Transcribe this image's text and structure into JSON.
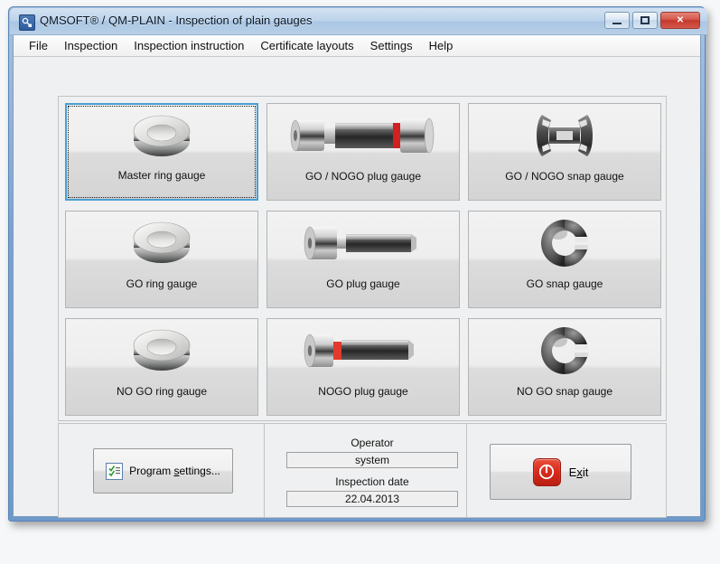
{
  "window": {
    "title": "QMSOFT® / QM-PLAIN - Inspection of plain gauges",
    "app_icon": "qm-app-icon",
    "controls": {
      "minimize": "minimize-button",
      "maximize": "maximize-button",
      "close": "✕"
    },
    "accent_blue": "#6e9ac9",
    "close_red": "#c3392c"
  },
  "menu": {
    "items": [
      {
        "label": "File"
      },
      {
        "label": "Inspection"
      },
      {
        "label": "Inspection instruction"
      },
      {
        "label": "Certificate layouts"
      },
      {
        "label": "Settings"
      },
      {
        "label": "Help"
      }
    ]
  },
  "gauges": {
    "tiles": [
      {
        "label": "Master ring gauge",
        "art": "ring-gauge",
        "selected": true
      },
      {
        "label": "GO / NOGO plug gauge",
        "art": "double-plug-gauge",
        "selected": false
      },
      {
        "label": "GO / NOGO snap gauge",
        "art": "double-snap-gauge",
        "selected": false
      },
      {
        "label": "GO ring gauge",
        "art": "ring-gauge",
        "selected": false
      },
      {
        "label": "GO plug gauge",
        "art": "plug-gauge",
        "selected": false
      },
      {
        "label": "GO snap gauge",
        "art": "snap-gauge",
        "selected": false
      },
      {
        "label": "NO GO ring gauge",
        "art": "ring-gauge",
        "selected": false
      },
      {
        "label": "NOGO plug gauge",
        "art": "nogo-plug-gauge",
        "selected": false
      },
      {
        "label": "NO GO snap gauge",
        "art": "snap-gauge",
        "selected": false
      }
    ]
  },
  "bottom": {
    "settings_button": {
      "label_before": "Program ",
      "accel": "s",
      "label_after": "ettings..."
    },
    "operator": {
      "label": "Operator",
      "value": "system"
    },
    "inspection_date": {
      "label": "Inspection date",
      "value": "22.04.2013"
    },
    "exit_button": {
      "label_before": "E",
      "accel": "x",
      "label_after": "it"
    }
  }
}
